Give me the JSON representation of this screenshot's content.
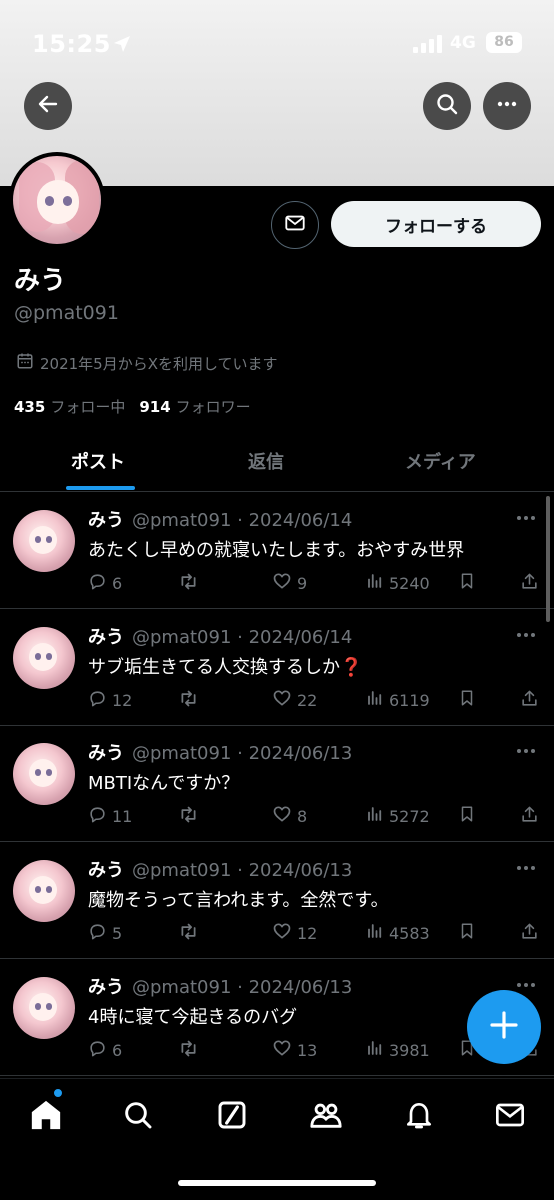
{
  "status_bar": {
    "time": "15:25",
    "network": "4G",
    "battery": "86"
  },
  "profile": {
    "name": "みう",
    "handle": "@pmat091",
    "joined": "2021年5月からXを利用しています",
    "following_count": "435",
    "following_label": "フォロー中",
    "followers_count": "914",
    "followers_label": "フォロワー",
    "follow_button": "フォローする"
  },
  "tabs": [
    {
      "label": "ポスト",
      "active": true
    },
    {
      "label": "返信",
      "active": false
    },
    {
      "label": "メディア",
      "active": false
    }
  ],
  "posts": [
    {
      "name": "みう",
      "meta": "@pmat091 · 2024/06/14",
      "text": "あたくし早めの就寝いたします。おやすみ世界",
      "replies": "6",
      "likes": "9",
      "views": "5240"
    },
    {
      "name": "みう",
      "meta": "@pmat091 · 2024/06/14",
      "text": "サブ垢生きてる人交換するしか❓",
      "replies": "12",
      "likes": "22",
      "views": "6119"
    },
    {
      "name": "みう",
      "meta": "@pmat091 · 2024/06/13",
      "text": "MBTIなんですか？",
      "replies": "11",
      "likes": "8",
      "views": "5272"
    },
    {
      "name": "みう",
      "meta": "@pmat091 · 2024/06/13",
      "text": "魔物そうって言われます。全然です。",
      "replies": "5",
      "likes": "12",
      "views": "4583"
    },
    {
      "name": "みう",
      "meta": "@pmat091 · 2024/06/13",
      "text": "4時に寝て今起きるのバグ",
      "replies": "6",
      "likes": "13",
      "views": "3981"
    }
  ],
  "icons": {
    "back": "arrow-left-icon",
    "search": "search-icon",
    "more": "more-horizontal-icon",
    "message": "envelope-icon",
    "compose": "plus-icon",
    "nav": [
      "home-icon",
      "search-icon",
      "grok-icon",
      "communities-icon",
      "bell-icon",
      "mail-icon"
    ]
  },
  "colors": {
    "accent": "#1d9bf0",
    "background": "#000000",
    "muted": "#71767b"
  }
}
